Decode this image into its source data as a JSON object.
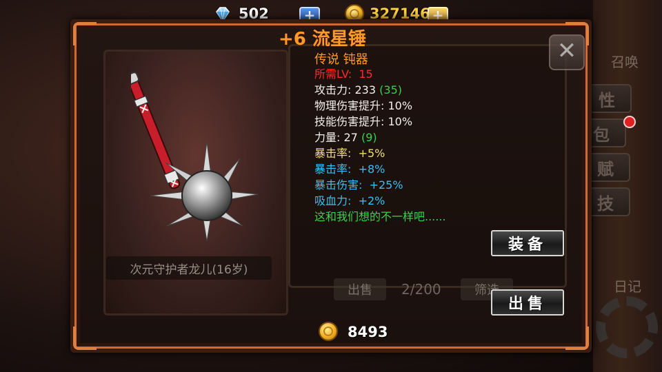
{
  "currency": {
    "diamonds": "502",
    "gold": "327146"
  },
  "item": {
    "title": "+6 流星锤",
    "rarity": "传说 钝器",
    "stats": [
      {
        "label": "所需LV:",
        "value": "15",
        "color": "#ff2a2a"
      },
      {
        "label": "攻击力:",
        "value": "233",
        "bonus": "(35)"
      },
      {
        "label": "物理伤害提升:",
        "value": "10%"
      },
      {
        "label": "技能伤害提升:",
        "value": "10%"
      },
      {
        "label": "力量:",
        "value": "27",
        "bonus": "(9)"
      },
      {
        "label": "暴击率:",
        "value": "+5%",
        "color": "#f0e070"
      },
      {
        "label": "暴击率:",
        "value": "+8%",
        "color": "#3ac0f0"
      },
      {
        "label": "暴击伤害:",
        "value": "+25%",
        "color": "#3ac0f0"
      },
      {
        "label": "吸血力:",
        "value": "+2%",
        "color": "#3ac0f0"
      }
    ],
    "flavor": "这和我们想的不一样吧......",
    "price": "8493"
  },
  "actions": {
    "equip": "装备",
    "sell": "出售"
  },
  "background": {
    "character_name": "次元守护者龙儿(16岁)",
    "sell_label": "出售",
    "capacity": "2/200",
    "filter_label": "筛选",
    "side_menu": [
      "属性",
      "背包",
      "天赋",
      "武技"
    ],
    "summon_label": "召唤",
    "diary_label": "日记"
  },
  "colors": {
    "title_orange": "#ff9a28",
    "frame_accent": "#d06a30"
  }
}
